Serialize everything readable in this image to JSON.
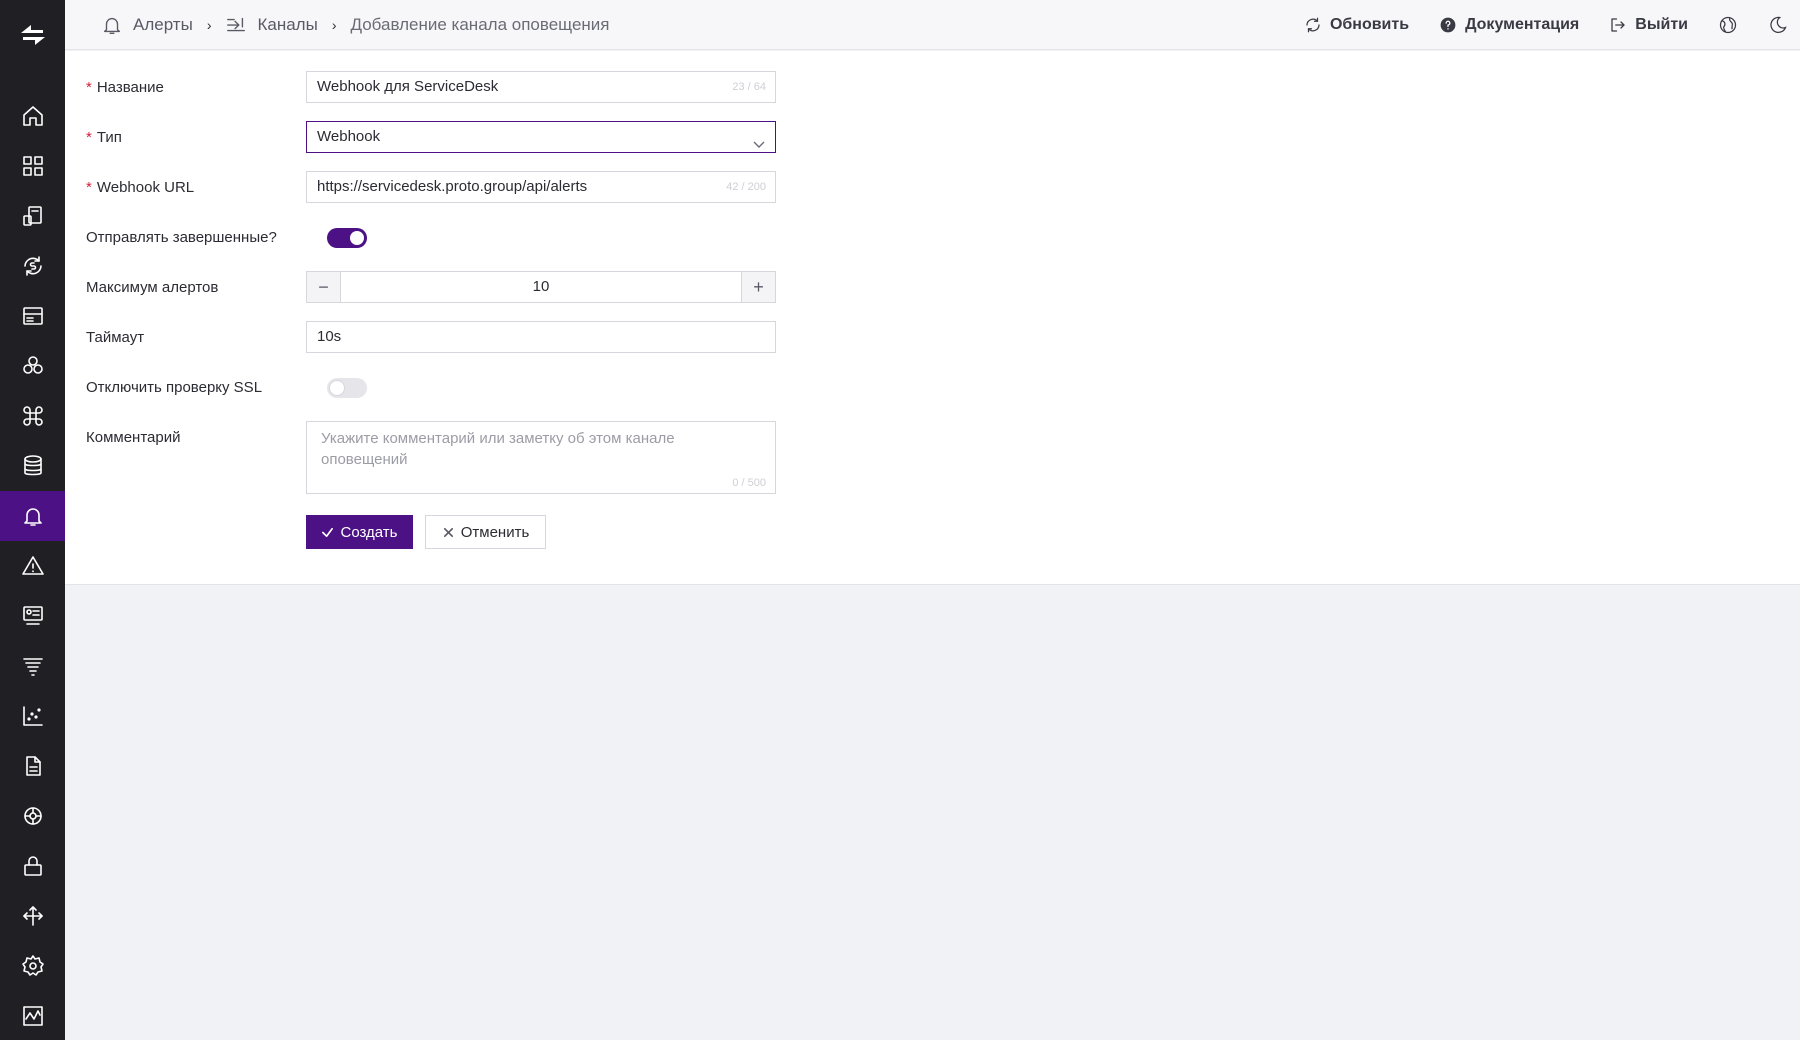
{
  "breadcrumb": {
    "items": [
      {
        "label": "Алерты",
        "icon": "bell-icon"
      },
      {
        "label": "Каналы",
        "icon": "channel-arrow-icon"
      }
    ],
    "current": "Добавление канала оповещения"
  },
  "topbar": {
    "refresh_label": "Обновить",
    "docs_label": "Документация",
    "logout_label": "Выйти",
    "language_icon": "globe-icon",
    "theme_icon": "moon-icon"
  },
  "sidebar": {
    "logo_icon": "logo-icon",
    "active_item": "alerts",
    "items": [
      "home-icon",
      "dashboard-grid-icon",
      "devices-icon",
      "sync-icon",
      "server-icon",
      "hexagons-icon",
      "command-icon",
      "database-icon",
      "bell-icon",
      "warning-icon",
      "monitor-icon",
      "filter-list-icon",
      "scatter-chart-icon",
      "document-icon",
      "network-icon",
      "lock-icon",
      "move-arrows-icon",
      "gear-icon",
      "activity-chart-icon"
    ]
  },
  "form": {
    "name": {
      "label": "Название",
      "value": "Webhook для ServiceDesk",
      "counter": "23 / 64"
    },
    "type": {
      "label": "Тип",
      "value": "Webhook"
    },
    "url": {
      "label": "Webhook URL",
      "value": "https://servicedesk.proto.group/api/alerts",
      "counter": "42 / 200"
    },
    "send_resolved": {
      "label": "Отправлять завершенные?",
      "enabled": true
    },
    "max_alerts": {
      "label": "Максимум алертов",
      "value": "10",
      "minus": "−",
      "plus": "+"
    },
    "timeout": {
      "label": "Таймаут",
      "value": "10s"
    },
    "ssl": {
      "label": "Отключить проверку SSL",
      "enabled": false
    },
    "comment": {
      "label": "Комментарий",
      "placeholder": "Укажите комментарий или заметку об этом канале оповещений",
      "counter": "0 / 500"
    },
    "required_mark": "*",
    "create_label": "Создать",
    "cancel_label": "Отменить"
  },
  "colors": {
    "accent": "#4c1285",
    "sidebar": "#1f1f24",
    "required": "#d21f3c"
  }
}
